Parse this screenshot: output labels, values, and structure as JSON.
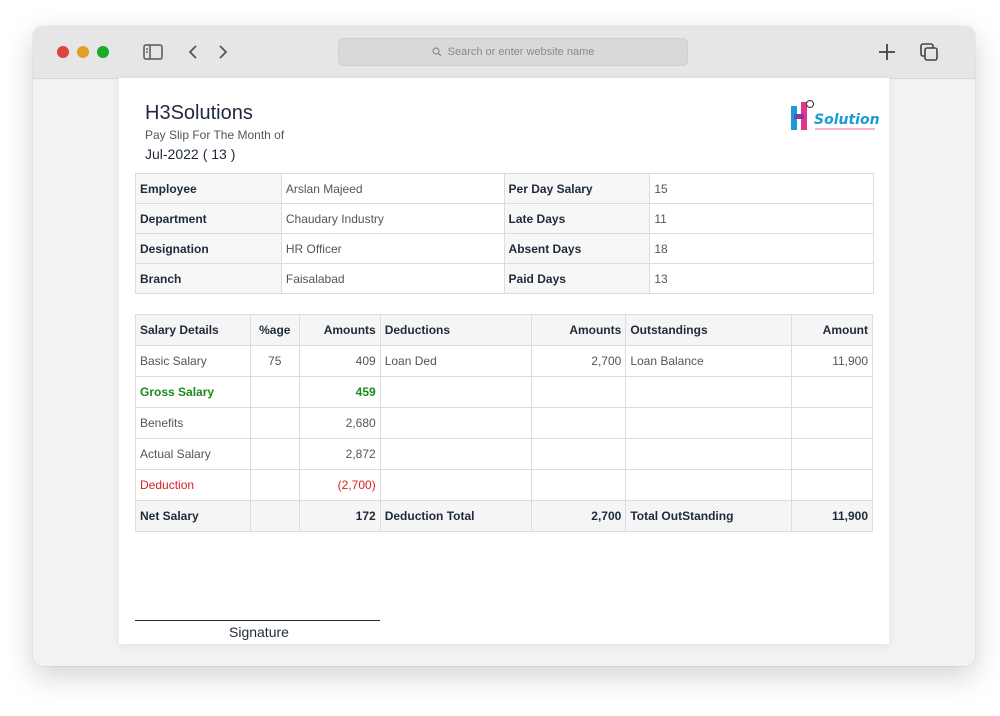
{
  "browser": {
    "address_placeholder": "Search or enter website name",
    "icons": [
      "sidebar-icon",
      "back-icon",
      "forward-icon",
      "search-icon",
      "new-tab-icon",
      "tabs-icon"
    ]
  },
  "payslip": {
    "company": "H3Solutions",
    "subtitle": "Pay Slip For The Month of",
    "month": "Jul-2022",
    "paid_days_paren": "( 13 )",
    "logo_text": "Solutions",
    "logo_mark": "H3"
  },
  "info": [
    {
      "label": "Employee",
      "value": "Arslan Majeed",
      "label2": "Per Day Salary",
      "value2": "15"
    },
    {
      "label": "Department",
      "value": "Chaudary Industry",
      "label2": "Late Days",
      "value2": "11"
    },
    {
      "label": "Designation",
      "value": "HR Officer",
      "label2": "Absent Days",
      "value2": "18"
    },
    {
      "label": "Branch",
      "value": "Faisalabad",
      "label2": "Paid Days",
      "value2": "13"
    }
  ],
  "salary": {
    "headers": [
      "Salary Details",
      "%age",
      "Amounts",
      "Deductions",
      "Amounts",
      "Outstandings",
      "Amount"
    ],
    "rows": [
      [
        "Basic Salary",
        "75",
        "409",
        "Loan Ded",
        "2,700",
        "Loan Balance",
        "11,900"
      ],
      [
        "Gross Salary",
        "",
        "459",
        "",
        "",
        "",
        ""
      ],
      [
        "Benefits",
        "",
        "2,680",
        "",
        "",
        "",
        ""
      ],
      [
        "Actual Salary",
        "",
        "2,872",
        "",
        "",
        "",
        ""
      ],
      [
        "Deduction",
        "",
        "(2,700)",
        "",
        "",
        "",
        ""
      ]
    ],
    "total": [
      "Net Salary",
      "",
      "172",
      "Deduction Total",
      "2,700",
      "Total OutStanding",
      "11,900"
    ]
  },
  "signature": "Signature",
  "colors": {
    "gross": "#1a8a1a",
    "deduction": "#d92020",
    "logo_pink": "#e8338a",
    "logo_blue": "#1a9ad6"
  }
}
